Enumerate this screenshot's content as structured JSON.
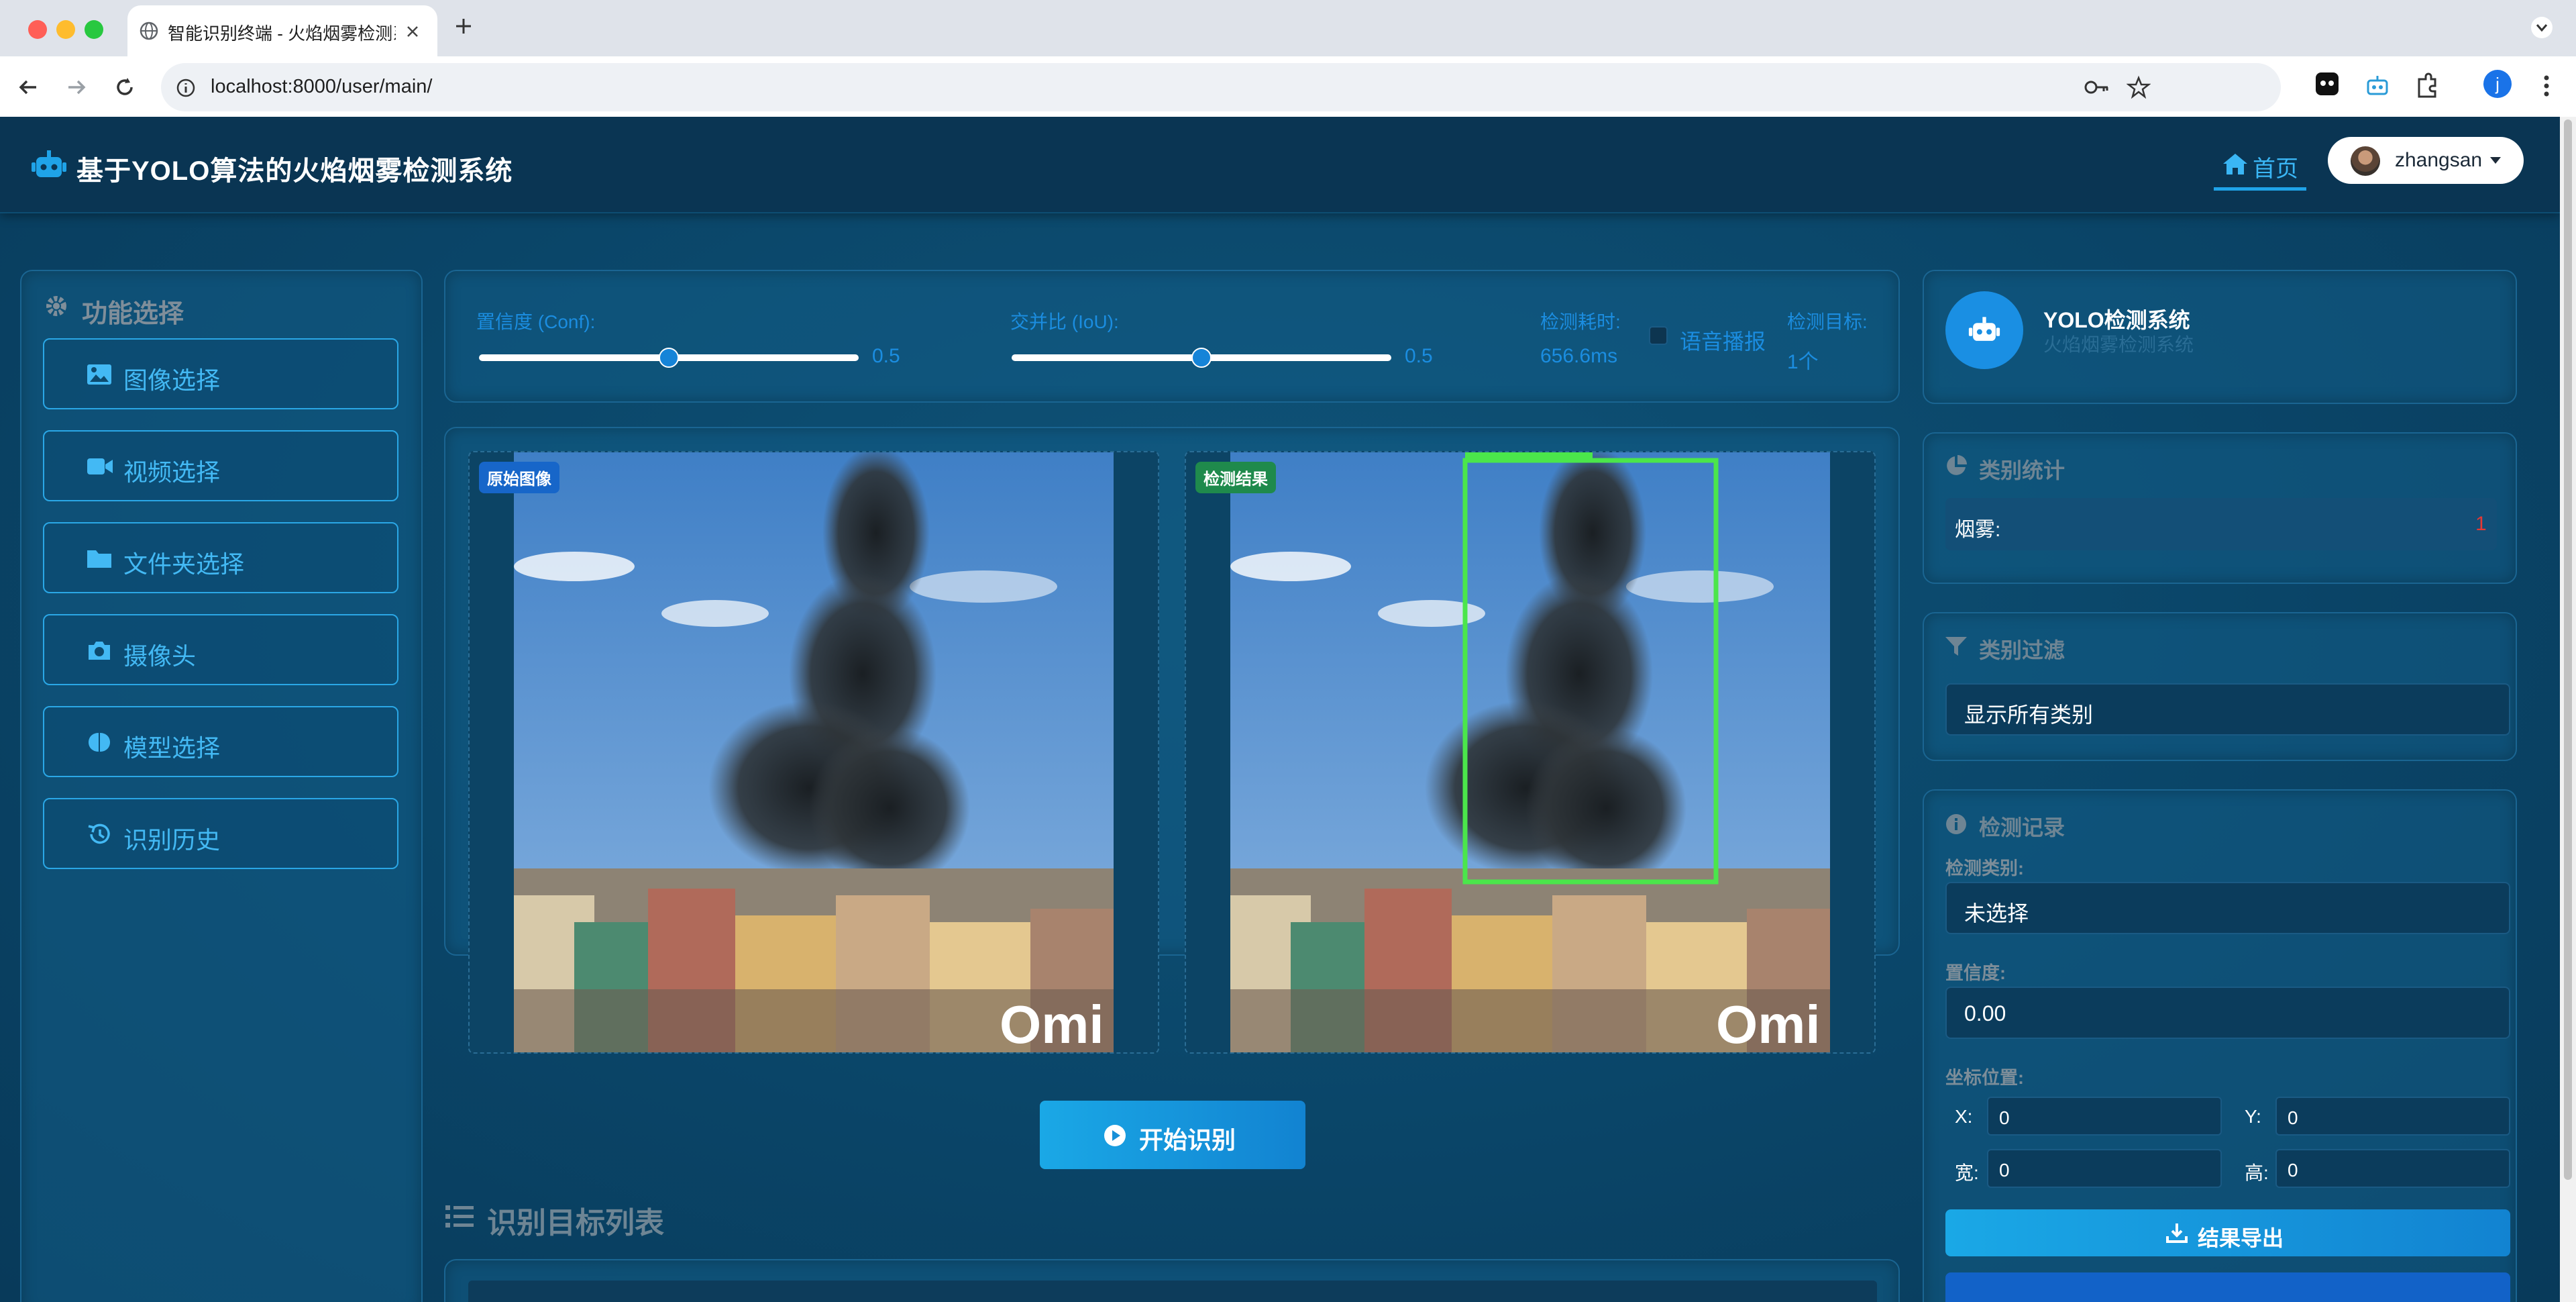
{
  "browser": {
    "tab_title": "智能识别终端 - 火焰烟雾检测系统",
    "url": "localhost:8000/user/main/",
    "profile_initial": "j"
  },
  "app": {
    "title": "基于YOLO算法的火焰烟雾检测系统",
    "nav_home": "首页",
    "username": "zhangsan"
  },
  "sidebar": {
    "heading": "功能选择",
    "items": [
      {
        "label": "图像选择",
        "icon": "image-icon"
      },
      {
        "label": "视频选择",
        "icon": "video-icon"
      },
      {
        "label": "文件夹选择",
        "icon": "folder-icon"
      },
      {
        "label": "摄像头",
        "icon": "camera-icon"
      },
      {
        "label": "模型选择",
        "icon": "brain-icon"
      },
      {
        "label": "识别历史",
        "icon": "history-icon"
      }
    ]
  },
  "controls": {
    "conf_label": "置信度 (Conf):",
    "conf_value": "0.5",
    "conf_fraction": 0.5,
    "iou_label": "交并比 (IoU):",
    "iou_value": "0.5",
    "iou_fraction": 0.5,
    "time_label": "检测耗时:",
    "time_value": "656.6ms",
    "voice_label": "语音播报",
    "voice_checked": false,
    "target_label": "检测目标:",
    "target_value": "1个"
  },
  "images": {
    "original_badge": "原始图像",
    "result_badge": "检测结果",
    "watermark": "Omi"
  },
  "start_button": "开始识别",
  "target_list_title": "识别目标列表",
  "right": {
    "system_name": "YOLO检测系统",
    "system_subtitle": "火焰烟雾检测系统",
    "stats_title": "类别统计",
    "stats": [
      {
        "name": "烟雾:",
        "count": "1"
      }
    ],
    "filter_title": "类别过滤",
    "filter_selected": "显示所有类别",
    "record_title": "检测记录",
    "record_class_label": "检测类别:",
    "record_class_value": "未选择",
    "record_conf_label": "置信度:",
    "record_conf_value": "0.00",
    "record_pos_label": "坐标位置:",
    "x_label": "X:",
    "x_value": "0",
    "y_label": "Y:",
    "y_value": "0",
    "w_label": "宽:",
    "w_value": "0",
    "h_label": "高:",
    "h_value": "0",
    "export_button": "结果导出"
  },
  "colors": {
    "accent": "#1fa3e8",
    "header_bg": "#0a3553",
    "detect_box": "#4be64b",
    "stat_count": "#e53935",
    "original_badge": "#1766c9",
    "result_badge": "#1f8a4c"
  }
}
